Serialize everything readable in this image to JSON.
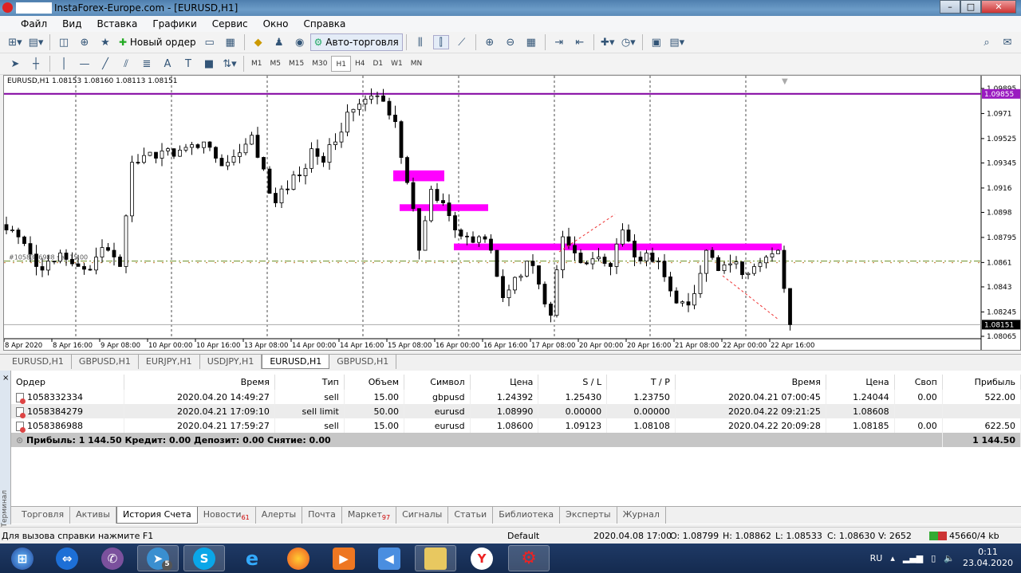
{
  "window": {
    "title": "InstaForex-Europe.com - [EURUSD,H1]"
  },
  "menu": [
    "Файл",
    "Вид",
    "Вставка",
    "Графики",
    "Сервис",
    "Окно",
    "Справка"
  ],
  "toolbar": {
    "new_order": "Новый ордер",
    "autotrading": "Авто-торговля"
  },
  "timeframes": [
    "M1",
    "M5",
    "M15",
    "M30",
    "H1",
    "H4",
    "D1",
    "W1",
    "MN"
  ],
  "active_timeframe": "H1",
  "chart": {
    "info": "EURUSD,H1  1.08153 1.08160 1.08113 1.08151",
    "line_label": "#1058386988 sell 15.00",
    "current_price": "1.08151",
    "purple_level": "1.09855",
    "top_price": "1.09895"
  },
  "chart_data": {
    "type": "candlestick",
    "symbol": "EURUSD",
    "timeframe": "H1",
    "ylim": [
      1.0801,
      1.0993
    ],
    "price_ticks": [
      1.09895,
      1.0971,
      1.09525,
      1.09345,
      1.0916,
      1.0898,
      1.08795,
      1.0861,
      1.0843,
      1.08245,
      1.08065
    ],
    "date_labels": [
      "8 Apr 2020",
      "8 Apr 16:00",
      "9 Apr 08:00",
      "10 Apr 00:00",
      "10 Apr 16:00",
      "13 Apr 08:00",
      "14 Apr 00:00",
      "14 Apr 16:00",
      "15 Apr 08:00",
      "16 Apr 00:00",
      "16 Apr 16:00",
      "17 Apr 08:00",
      "20 Apr 00:00",
      "20 Apr 16:00",
      "21 Apr 08:00",
      "22 Apr 00:00",
      "22 Apr 16:00"
    ],
    "closes": [
      1.0885,
      1.0875,
      1.0858,
      1.0862,
      1.0868,
      1.086,
      1.0856,
      1.0865,
      1.087,
      1.0858,
      1.0935,
      1.094,
      1.0938,
      1.0945,
      1.0944,
      1.0948,
      1.095,
      1.0938,
      1.0935,
      1.0942,
      1.0955,
      1.093,
      1.0905,
      1.0915,
      1.0925,
      1.0945,
      1.0935,
      1.095,
      1.0972,
      1.0978,
      1.0984,
      1.098,
      1.0965,
      1.092,
      1.087,
      1.0915,
      1.0905,
      1.0885,
      1.088,
      1.088,
      1.087,
      1.0835,
      1.085,
      1.0862,
      1.0845,
      1.0822,
      1.088,
      1.0868,
      1.086,
      1.0865,
      1.0858,
      1.0885,
      1.0865,
      1.0868,
      1.0862,
      1.084,
      1.0832,
      1.0838,
      1.087,
      1.0855,
      1.086,
      1.0852,
      1.0858,
      1.0865,
      1.087,
      1.08151
    ],
    "levels": {
      "purple": 1.09855,
      "order_line": 1.0862,
      "bid": 1.08151
    },
    "zones": [
      {
        "from": 1.0929,
        "to": 1.0921
      },
      {
        "from": 1.0904,
        "to": 1.0899
      },
      {
        "from": 1.0875,
        "to": 1.087
      }
    ]
  },
  "chart_tabs": [
    "EURUSD,H1",
    "GBPUSD,H1",
    "EURJPY,H1",
    "USDJPY,H1",
    "EURUSD,H1",
    "GBPUSD,H1"
  ],
  "active_chart_tab": 4,
  "terminal": {
    "side_label": "Терминал",
    "columns": [
      "Ордер",
      "Время",
      "Тип",
      "Объем",
      "Символ",
      "Цена",
      "S / L",
      "T / P",
      "Время",
      "Цена",
      "Своп",
      "Прибыль"
    ],
    "rows": [
      [
        "1058332334",
        "2020.04.20 14:49:27",
        "sell",
        "15.00",
        "gbpusd",
        "1.24392",
        "1.25430",
        "1.23750",
        "2020.04.21 07:00:45",
        "1.24044",
        "0.00",
        "522.00"
      ],
      [
        "1058384279",
        "2020.04.21 17:09:10",
        "sell limit",
        "50.00",
        "eurusd",
        "1.08990",
        "0.00000",
        "0.00000",
        "2020.04.22 09:21:25",
        "1.08608",
        "",
        ""
      ],
      [
        "1058386988",
        "2020.04.21 17:59:27",
        "sell",
        "15.00",
        "eurusd",
        "1.08600",
        "1.09123",
        "1.08108",
        "2020.04.22 20:09:28",
        "1.08185",
        "0.00",
        "622.50"
      ]
    ],
    "summary": "Прибыль: 1 144.50  Кредит: 0.00  Депозит: 0.00  Снятие: 0.00",
    "summary_total": "1 144.50",
    "tabs": [
      {
        "label": "Торговля"
      },
      {
        "label": "Активы"
      },
      {
        "label": "История Счета"
      },
      {
        "label": "Новости",
        "badge": "61"
      },
      {
        "label": "Алерты"
      },
      {
        "label": "Почта"
      },
      {
        "label": "Маркет",
        "badge": "97"
      },
      {
        "label": "Сигналы"
      },
      {
        "label": "Статьи"
      },
      {
        "label": "Библиотека"
      },
      {
        "label": "Эксперты"
      },
      {
        "label": "Журнал"
      }
    ],
    "active_tab": 2
  },
  "status": {
    "help": "Для вызова справки нажмите F1",
    "profile": "Default",
    "time": "2020.04.08 17:00",
    "open": "O: 1.08799",
    "high": "H: 1.08862",
    "low": "L: 1.08533",
    "close": "C: 1.08630",
    "volume": "V: 2652",
    "traffic": "45660/4 kb"
  },
  "taskbar": {
    "lang": "RU",
    "clock": "0:11",
    "date": "23.04.2020",
    "telegram_badge": "5"
  }
}
